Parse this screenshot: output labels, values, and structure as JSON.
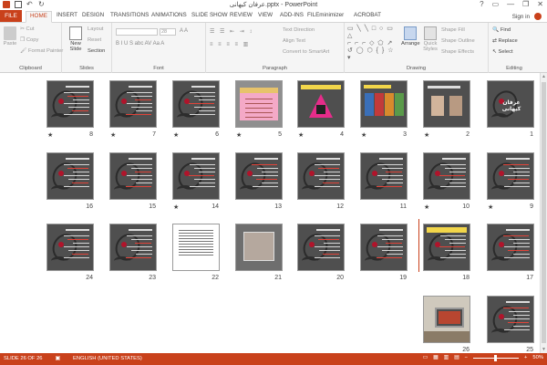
{
  "window": {
    "title": "عرفان کیهانی.pptx - PowerPoint",
    "controls": [
      "?",
      "▭",
      "—",
      "❐",
      "✕"
    ]
  },
  "tabs": {
    "file": "FILE",
    "items": [
      "HOME",
      "INSERT",
      "DESIGN",
      "TRANSITIONS",
      "ANIMATIONS",
      "SLIDE SHOW",
      "REVIEW",
      "VIEW",
      "ADD-INS",
      "FILEminimizer",
      "ACROBAT"
    ],
    "signin": "Sign in"
  },
  "ribbon": {
    "clipboard": {
      "label": "Clipboard",
      "paste": "Paste",
      "cut": "Cut",
      "copy": "Copy",
      "painter": "Format Painter"
    },
    "slides": {
      "label": "Slides",
      "new_slide": "New Slide",
      "layout": "Layout",
      "reset": "Reset",
      "section": "Section"
    },
    "font": {
      "label": "Font",
      "font_size": "28",
      "buttons": "B I U S abc AV Aa A",
      "grow": "A A"
    },
    "paragraph": {
      "label": "Paragraph",
      "text_direction": "Text Direction",
      "align_text": "Align Text",
      "convert": "Convert to SmartArt"
    },
    "drawing": {
      "label": "Drawing",
      "arrange": "Arrange",
      "quick_styles": "Quick Styles",
      "fill": "Shape Fill",
      "outline": "Shape Outline",
      "effects": "Shape Effects"
    },
    "editing": {
      "label": "Editing",
      "find": "Find",
      "replace": "Replace",
      "select": "Select"
    }
  },
  "slides": [
    {
      "num": "1",
      "star": false,
      "style": "slide1",
      "text": "عرفان کیهانی"
    },
    {
      "num": "2",
      "star": true,
      "style": "people"
    },
    {
      "num": "3",
      "star": true,
      "style": "books"
    },
    {
      "num": "4",
      "star": true,
      "style": "tri"
    },
    {
      "num": "5",
      "star": true,
      "style": "pink"
    },
    {
      "num": "6",
      "star": true,
      "style": "dark"
    },
    {
      "num": "7",
      "star": true,
      "style": "dark"
    },
    {
      "num": "8",
      "star": true,
      "style": "dark"
    },
    {
      "num": "9",
      "star": true,
      "style": "dark"
    },
    {
      "num": "10",
      "star": true,
      "style": "dark"
    },
    {
      "num": "11",
      "star": false,
      "style": "dark"
    },
    {
      "num": "12",
      "star": false,
      "style": "dark"
    },
    {
      "num": "13",
      "star": false,
      "style": "dark"
    },
    {
      "num": "14",
      "star": true,
      "style": "dark"
    },
    {
      "num": "15",
      "star": false,
      "style": "dark"
    },
    {
      "num": "16",
      "star": false,
      "style": "dark"
    },
    {
      "num": "17",
      "star": false,
      "style": "dark"
    },
    {
      "num": "18",
      "star": false,
      "style": "yellowtop"
    },
    {
      "num": "19",
      "star": false,
      "style": "dark"
    },
    {
      "num": "20",
      "star": false,
      "style": "dark"
    },
    {
      "num": "21",
      "star": false,
      "style": "texture"
    },
    {
      "num": "22",
      "star": false,
      "style": "doc"
    },
    {
      "num": "23",
      "star": false,
      "style": "dark"
    },
    {
      "num": "24",
      "star": false,
      "style": "dark"
    },
    {
      "num": "25",
      "star": false,
      "style": "dark"
    },
    {
      "num": "26",
      "star": false,
      "style": "photo"
    }
  ],
  "status": {
    "slide": "SLIDE 26 OF 26",
    "language": "ENGLISH (UNITED STATES)",
    "zoom": "50%",
    "zoom_fraction": 0.5
  },
  "colors": {
    "accent": "#c9411b"
  }
}
